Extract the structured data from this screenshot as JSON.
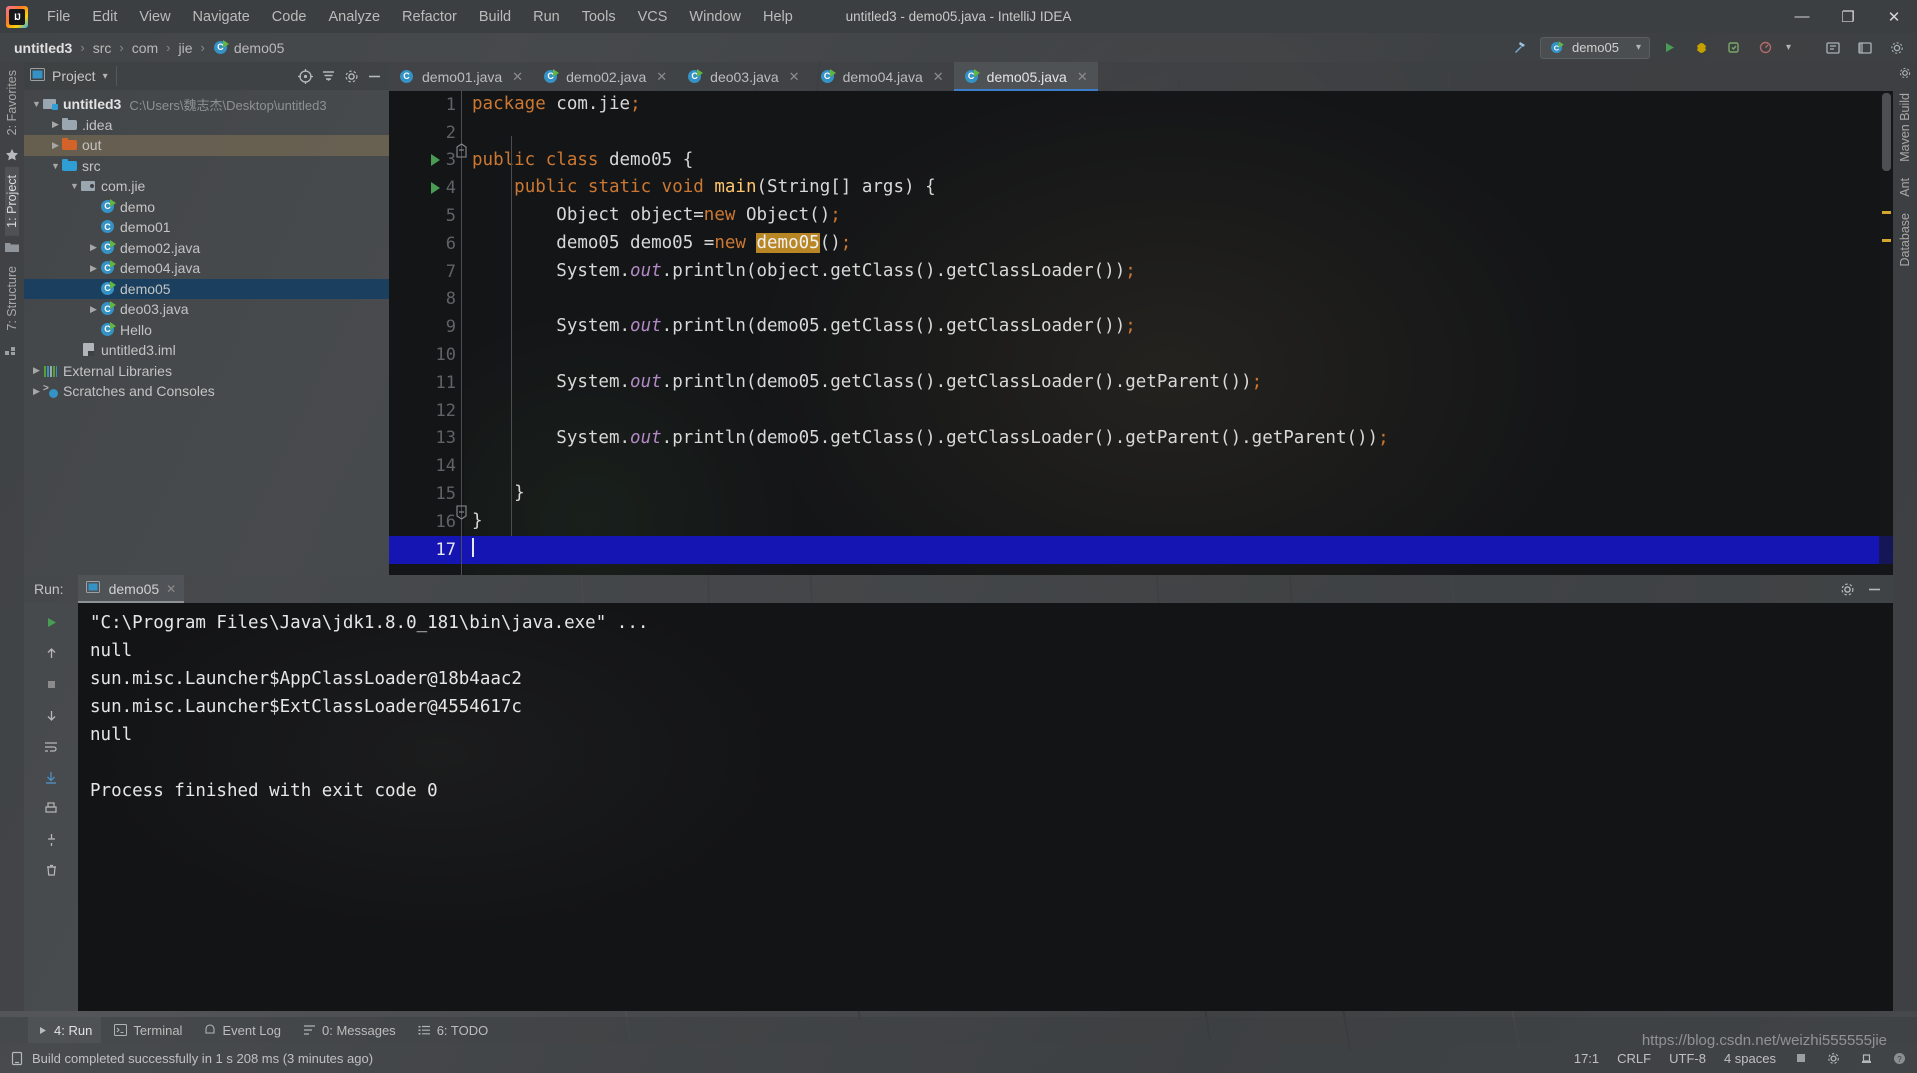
{
  "window": {
    "title": "untitled3 - demo05.java - IntelliJ IDEA",
    "minimize": "—",
    "maximize": "❐",
    "close": "✕"
  },
  "menubar": {
    "items": [
      {
        "label": "File"
      },
      {
        "label": "Edit"
      },
      {
        "label": "View"
      },
      {
        "label": "Navigate"
      },
      {
        "label": "Code"
      },
      {
        "label": "Analyze"
      },
      {
        "label": "Refactor"
      },
      {
        "label": "Build"
      },
      {
        "label": "Run"
      },
      {
        "label": "Tools"
      },
      {
        "label": "VCS"
      },
      {
        "label": "Window"
      },
      {
        "label": "Help"
      }
    ]
  },
  "navbar": {
    "crumbs": [
      "untitled3",
      "src",
      "com",
      "jie",
      "demo05"
    ],
    "separator": "›",
    "run_configuration": "demo05",
    "dropdown_caret": "▾"
  },
  "left_strip": {
    "favorites": "2: Favorites",
    "project": "1: Project",
    "structure": "7: Structure"
  },
  "right_strip": {
    "maven": "Maven Build",
    "ant": "Ant",
    "database": "Database"
  },
  "project_panel": {
    "title": "Project",
    "caret": "▾",
    "tree": [
      {
        "depth": 0,
        "twisty": "▼",
        "icon": "module-icon",
        "label": "untitled3",
        "bold": true,
        "path": "C:\\Users\\魏志杰\\Desktop\\untitled3",
        "state": "normal"
      },
      {
        "depth": 1,
        "twisty": "▶",
        "icon": "folder-icon",
        "label": ".idea",
        "state": "normal"
      },
      {
        "depth": 1,
        "twisty": "▶",
        "icon": "folder-orange-icon",
        "label": "out",
        "state": "highlight"
      },
      {
        "depth": 1,
        "twisty": "▼",
        "icon": "folder-blue-icon",
        "label": "src",
        "state": "normal"
      },
      {
        "depth": 2,
        "twisty": "▼",
        "icon": "package-icon",
        "label": "com.jie",
        "state": "normal"
      },
      {
        "depth": 3,
        "twisty": "",
        "icon": "java-class-runnable-icon",
        "label": "demo",
        "state": "normal"
      },
      {
        "depth": 3,
        "twisty": "",
        "icon": "java-class-icon",
        "label": "demo01",
        "state": "normal"
      },
      {
        "depth": 3,
        "twisty": "▶",
        "icon": "java-class-runnable-icon",
        "label": "demo02.java",
        "state": "normal"
      },
      {
        "depth": 3,
        "twisty": "▶",
        "icon": "java-class-runnable-icon",
        "label": "demo04.java",
        "state": "normal"
      },
      {
        "depth": 3,
        "twisty": "",
        "icon": "java-class-runnable-icon",
        "label": "demo05",
        "state": "selected"
      },
      {
        "depth": 3,
        "twisty": "▶",
        "icon": "java-class-runnable-icon",
        "label": "deo03.java",
        "state": "normal"
      },
      {
        "depth": 3,
        "twisty": "",
        "icon": "java-class-runnable-icon",
        "label": "Hello",
        "state": "normal"
      },
      {
        "depth": 2,
        "twisty": "",
        "icon": "iml-file-icon",
        "label": "untitled3.iml",
        "state": "normal"
      },
      {
        "depth": 0,
        "twisty": "▶",
        "icon": "library-icon",
        "label": "External Libraries",
        "state": "normal"
      },
      {
        "depth": 0,
        "twisty": "▶",
        "icon": "scratch-icon",
        "label": "Scratches and Consoles",
        "state": "normal"
      }
    ]
  },
  "editor": {
    "tabs": [
      {
        "label": "demo01.java",
        "icon": "java-class-icon",
        "active": false,
        "close": "✕"
      },
      {
        "label": "demo02.java",
        "icon": "java-class-runnable-icon",
        "active": false,
        "close": "✕"
      },
      {
        "label": "deo03.java",
        "icon": "java-class-runnable-icon",
        "active": false,
        "close": "✕"
      },
      {
        "label": "demo04.java",
        "icon": "java-class-runnable-icon",
        "active": false,
        "close": "✕"
      },
      {
        "label": "demo05.java",
        "icon": "java-class-runnable-icon",
        "active": true,
        "close": "✕"
      }
    ],
    "lines": [
      {
        "n": "1",
        "runmark": false,
        "current": false,
        "tokens": [
          {
            "t": "package ",
            "c": "kw"
          },
          {
            "t": "com.jie",
            "c": ""
          },
          {
            "t": ";",
            "c": "semi"
          }
        ]
      },
      {
        "n": "2",
        "runmark": false,
        "current": false,
        "tokens": []
      },
      {
        "n": "3",
        "runmark": true,
        "current": false,
        "tokens": [
          {
            "t": "public class ",
            "c": "kw"
          },
          {
            "t": "demo05 {",
            "c": ""
          }
        ]
      },
      {
        "n": "4",
        "runmark": true,
        "current": false,
        "tokens": [
          {
            "t": "    ",
            "c": ""
          },
          {
            "t": "public static void ",
            "c": "kw"
          },
          {
            "t": "main",
            "c": "meth"
          },
          {
            "t": "(String[] args) {",
            "c": ""
          }
        ]
      },
      {
        "n": "5",
        "runmark": false,
        "current": false,
        "tokens": [
          {
            "t": "        Object object=",
            "c": ""
          },
          {
            "t": "new ",
            "c": "kw"
          },
          {
            "t": "Object()",
            "c": ""
          },
          {
            "t": ";",
            "c": "semi"
          }
        ]
      },
      {
        "n": "6",
        "runmark": false,
        "current": false,
        "tokens": [
          {
            "t": "        demo05 demo05 =",
            "c": ""
          },
          {
            "t": "new ",
            "c": "kw"
          },
          {
            "t": "demo05",
            "c": "hl-token"
          },
          {
            "t": "()",
            "c": ""
          },
          {
            "t": ";",
            "c": "semi"
          }
        ]
      },
      {
        "n": "7",
        "runmark": false,
        "current": false,
        "tokens": [
          {
            "t": "        System.",
            "c": ""
          },
          {
            "t": "out",
            "c": "field-static"
          },
          {
            "t": ".println(object.getClass().getClassLoader())",
            "c": ""
          },
          {
            "t": ";",
            "c": "semi"
          }
        ]
      },
      {
        "n": "8",
        "runmark": false,
        "current": false,
        "tokens": []
      },
      {
        "n": "9",
        "runmark": false,
        "current": false,
        "tokens": [
          {
            "t": "        System.",
            "c": ""
          },
          {
            "t": "out",
            "c": "field-static"
          },
          {
            "t": ".println(demo05.getClass().getClassLoader())",
            "c": ""
          },
          {
            "t": ";",
            "c": "semi"
          }
        ]
      },
      {
        "n": "10",
        "runmark": false,
        "current": false,
        "tokens": []
      },
      {
        "n": "11",
        "runmark": false,
        "current": false,
        "tokens": [
          {
            "t": "        System.",
            "c": ""
          },
          {
            "t": "out",
            "c": "field-static"
          },
          {
            "t": ".println(demo05.getClass().getClassLoader().getParent())",
            "c": ""
          },
          {
            "t": ";",
            "c": "semi"
          }
        ]
      },
      {
        "n": "12",
        "runmark": false,
        "current": false,
        "tokens": []
      },
      {
        "n": "13",
        "runmark": false,
        "current": false,
        "tokens": [
          {
            "t": "        System.",
            "c": ""
          },
          {
            "t": "out",
            "c": "field-static"
          },
          {
            "t": ".println(demo05.getClass().getClassLoader().getParent().getParent())",
            "c": ""
          },
          {
            "t": ";",
            "c": "semi"
          }
        ]
      },
      {
        "n": "14",
        "runmark": false,
        "current": false,
        "tokens": []
      },
      {
        "n": "15",
        "runmark": false,
        "current": false,
        "tokens": [
          {
            "t": "    }",
            "c": ""
          }
        ]
      },
      {
        "n": "16",
        "runmark": false,
        "current": false,
        "tokens": [
          {
            "t": "}",
            "c": ""
          }
        ]
      },
      {
        "n": "17",
        "runmark": false,
        "current": true,
        "tokens": []
      }
    ]
  },
  "run_panel": {
    "label": "Run:",
    "tab": "demo05",
    "tab_close": "✕",
    "console_lines": [
      {
        "text": "\"C:\\Program Files\\Java\\jdk1.8.0_181\\bin\\java.exe\" ...",
        "boxed": true
      },
      {
        "text": "null",
        "boxed": false
      },
      {
        "text": "sun.misc.Launcher$AppClassLoader@18b4aac2",
        "boxed": false
      },
      {
        "text": "sun.misc.Launcher$ExtClassLoader@4554617c",
        "boxed": false
      },
      {
        "text": "null",
        "boxed": false
      },
      {
        "text": "",
        "boxed": false
      },
      {
        "text": "Process finished with exit code 0",
        "boxed": false
      }
    ]
  },
  "bottom_tabs": [
    {
      "label": "4: Run",
      "icon": "play-icon",
      "active": true
    },
    {
      "label": "Terminal",
      "icon": "terminal-icon",
      "active": false
    },
    {
      "label": "Event Log",
      "icon": "bell-icon",
      "active": false
    },
    {
      "label": "0: Messages",
      "icon": "messages-icon",
      "active": false
    },
    {
      "label": "6: TODO",
      "icon": "todo-icon",
      "active": false
    }
  ],
  "statusbar": {
    "message": "Build completed successfully in 1 s 208 ms (3 minutes ago)",
    "caret_position": "17:1",
    "line_separator": "CRLF",
    "encoding": "UTF-8",
    "indent": "4 spaces"
  },
  "watermark": "https://blog.csdn.net/weizhi555555jie",
  "colors": {
    "accent_blue": "#3592c4",
    "keyword_orange": "#cc7832",
    "method_yellow": "#ffc66d",
    "static_field_violet": "#b389c5",
    "highlight_amber": "#b98626",
    "selection_blue": "#1515b4",
    "tree_selection": "#1b405f",
    "run_green": "#499c54",
    "panel_gray": "#3c3f41",
    "editor_bg": "#161719"
  }
}
